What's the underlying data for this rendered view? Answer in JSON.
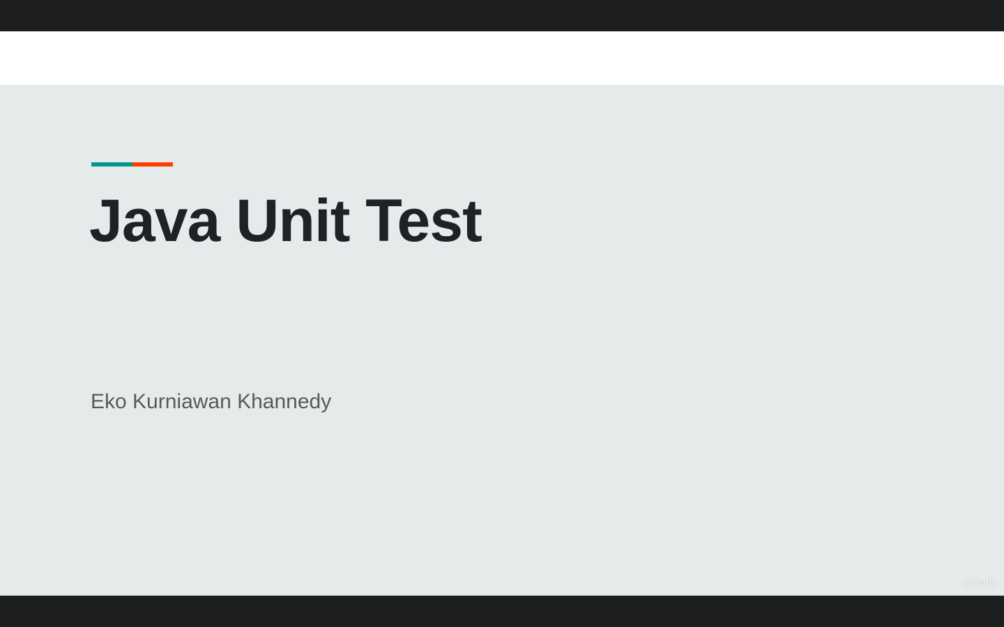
{
  "slide": {
    "title": "Java Unit Test",
    "author": "Eko Kurniawan Khannedy",
    "accent_colors": [
      "#009688",
      "#ff3d00"
    ]
  },
  "watermark": "Udemy"
}
